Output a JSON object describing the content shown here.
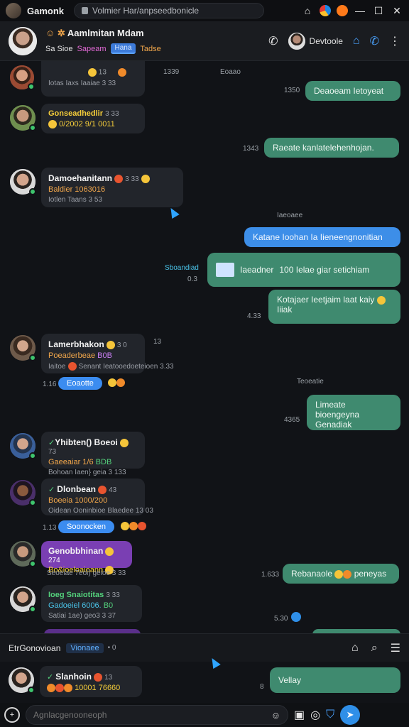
{
  "topbar": {
    "app_title": "Gamonk",
    "url": "Volmier Har/anpseedbonicle"
  },
  "header": {
    "name": "Aamlmitan Mdam",
    "sub_a": "Sa Sioe",
    "sub_b": "Sapeam",
    "sub_chip": "Hana",
    "sub_c": "Tadse",
    "contact_name": "Devtoole"
  },
  "messages": {
    "m0_left_a": "13",
    "m0_left_b": "1339",
    "m0_right_label": "Eoaao",
    "m0_meta": "Iotas Iaxs Iaaiae 3 33",
    "out1_time": "1350",
    "out1_text": "Deaoeam Ietoyeat",
    "m1_name": "Gonseadhedlir",
    "m1_count": "3 33",
    "m1_line": "0/2002 9/1 0011",
    "out2_time": "1343",
    "out2_text": "Raeate  kanlatelehenhojan.",
    "m2_name": "Damoehanitann",
    "m2_count": "3 33",
    "m2_line": "Baldier 1063016",
    "m2_meta": "Iotlen Taans 3 53",
    "sys1": "Iaeoaee",
    "out3_text": "Katane Ioohan Ia Iieneengnonitian",
    "out4_left": "Sboandiad",
    "out4_left_time": "0.3",
    "out4_a": "Iaeadner",
    "out4_b": "100 Ielae giar setichiam",
    "out5_time": "4.33",
    "out5_text": "Kotajaer Ieetjaim laat kaiy",
    "out5_text2": "Iiiak",
    "m3_name": "Lamerbhakon",
    "m3_count": "3 0",
    "m3_count2": "13",
    "m3_line_a": "Poeaderbeae",
    "m3_line_b": "B0B",
    "m3_meta_a": "Iaitoe",
    "m3_meta_b": "Senant Ieatooedoeteioen 3.33",
    "m3_time": "1.16",
    "m3_pill": "Eoaotte",
    "sys2": "Teoeatie",
    "out6_time": "4365",
    "out6_text": "Limeate bioengeyna",
    "out6_text2": "Genadiak",
    "m4_name": "Yhibten() Boeoi",
    "m4_count": "73",
    "m4_line_a": "Gaeeaiar 1/6",
    "m4_line_b": "BDB",
    "m4_meta": "Bohoan Iaen} geia 3 133",
    "m5_name": "Dlonbean",
    "m5_count": "43",
    "m5_line": "Boeeia 1000/200",
    "m5_meta": "Oidean Ooninbioe Blaedee 13 03",
    "m5_time": "1.13",
    "m5_pill": "Soonocken",
    "m6_name": "Genobbhinan",
    "m6_count": "274",
    "m6_line": "Bo&ioeloaioann",
    "m6_meta": "Seoeiae 7eoi) geioe 3 33",
    "out7_time": "1.633",
    "out7_text": "Rebanaole",
    "out7_text2": "peneyas",
    "m7_name": "Ioeg Snaiotitas",
    "m7_count": "3 33",
    "m7_line_a": "Gadoeiel 6006.",
    "m7_line_b": "B0",
    "m7_meta": "Satiai 1ae) geo3 3 37",
    "m7_time": "5.30"
  },
  "sub_header": {
    "title": "EtrGonovioan",
    "chip": "Vionaee",
    "suffix": "• 0"
  },
  "bottom": {
    "m8_name": "Slanhoin",
    "m8_count": "13",
    "m8_line": "10001 76660",
    "m8_meta": "8",
    "out8_text": "Vellay"
  },
  "composer": {
    "placeholder": "Agnlacgenooneoph"
  },
  "icons": {
    "lock": "lock-icon",
    "phone": "phone-icon",
    "more": "more-vertical-icon",
    "send": "send-icon"
  },
  "colors": {
    "green_bubble": "#3f8a6f",
    "blue_bubble": "#3d8ee8",
    "accent": "#2f8fe8"
  }
}
